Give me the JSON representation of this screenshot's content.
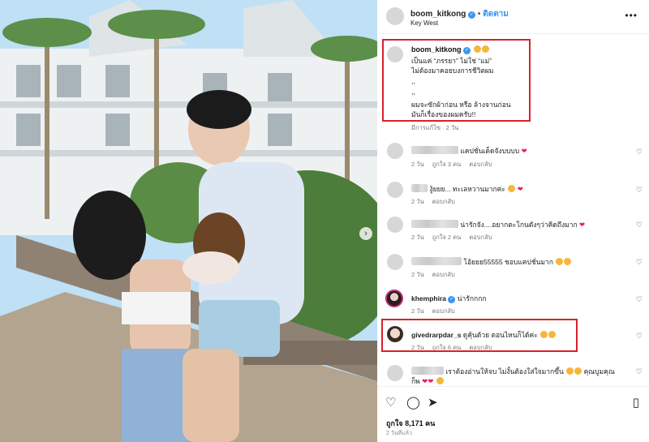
{
  "header": {
    "username": "boom_kitkong",
    "separator": "•",
    "follow_label": "ติดตาม",
    "location": "Key West",
    "more_icon": "more-icon"
  },
  "caption": {
    "username": "boom_kitkong",
    "lines": [
      "เป็นแค่ “ภรรยา” ไม่ใช่ “แม่”",
      "ไม่ต้องมาคอยบงการชีวิตผม",
      ",,",
      ",,",
      "ผมจะซักผ้าก่อน หรือ ล้างจานก่อน",
      "มันก็เรื่องของผมครับ!!"
    ],
    "meta": "มีการแก้ไข · 2 วัน"
  },
  "comments": [
    {
      "user": "",
      "text": "แคปชั่นเด็ดจังบบบบ",
      "time": "2 วัน",
      "likes": "ถูกใจ 3 คน",
      "reply": "ตอบกลับ",
      "heart_emoji": "❤"
    },
    {
      "user": "",
      "text": "งู้ยยย... ทะเลหวานมากค่ะ",
      "time": "2 วัน",
      "likes": "",
      "reply": "ตอบกลับ",
      "heart_emoji": "❤"
    },
    {
      "user": "",
      "text": "น่ารักจัง....อยากตะโกนดังๆว่าคิดถึงมาก",
      "time": "2 วัน",
      "likes": "ถูกใจ 2 คน",
      "reply": "ตอบกลับ",
      "heart_emoji": "❤"
    },
    {
      "user": "",
      "text": "โอ้ยยย55555 ชอบแคปชั่นมาก",
      "time": "2 วัน",
      "likes": "",
      "reply": "ตอบกลับ",
      "heart_emoji": ""
    },
    {
      "user": "khemphira",
      "text": "น่ารักกกก",
      "time": "2 วัน",
      "likes": "",
      "reply": "ตอบกลับ",
      "heart_emoji": ""
    },
    {
      "user": "givedrarpdar_s",
      "text": "ดูคุ้นด้วย ตอนไหนก็ได้ค่ะ",
      "time": "2 วัน",
      "likes": "ถูกใจ 6 คน",
      "reply": "ตอบกลับ",
      "heart_emoji": ""
    },
    {
      "user": "",
      "text": "เราต้องอ่านให้จบ ไม่งั้นต้องใส่ใจมากขึ้น",
      "text2": "ก็พ",
      "extra": "คุณบูมคุณ",
      "time": "",
      "likes": "",
      "reply": "",
      "heart_emoji": "❤❤"
    }
  ],
  "actions": {
    "like_icon": "heart-outline-icon",
    "comment_icon": "comment-icon",
    "share_icon": "share-icon",
    "save_icon": "bookmark-icon",
    "likes": "ถูกใจ 8,171 คน",
    "ago": "2 วันที่แล้ว"
  },
  "colors": {
    "highlight": "#d9212a",
    "link": "#3897f0"
  }
}
